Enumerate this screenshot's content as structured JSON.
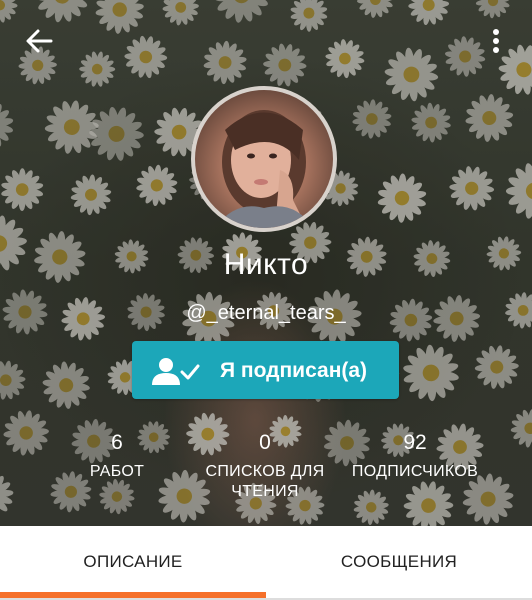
{
  "header": {
    "back_icon": "arrow-left-icon",
    "more_icon": "more-vertical-icon",
    "background": "daisy-field-photo",
    "avatar": "profile-photo"
  },
  "profile": {
    "name": "Никто",
    "handle": "@_eternal_tears_"
  },
  "follow_button": {
    "label": "Я подписан(а)",
    "icon": "user-check-icon",
    "color": "#1ca7b9"
  },
  "stats": {
    "works": {
      "value": "6",
      "label": "РАБОТ"
    },
    "reading_lists": {
      "value": "0",
      "label_line1": "СПИСКОВ ДЛЯ",
      "label_line2": "ЧТЕНИЯ"
    },
    "followers": {
      "value": "92",
      "label": "ПОДПИСЧИКОВ"
    }
  },
  "tabs": [
    {
      "label": "ОПИСАНИЕ",
      "active": true
    },
    {
      "label": "СООБЩЕНИЯ",
      "active": false
    }
  ],
  "accent_color": "#f5702a"
}
